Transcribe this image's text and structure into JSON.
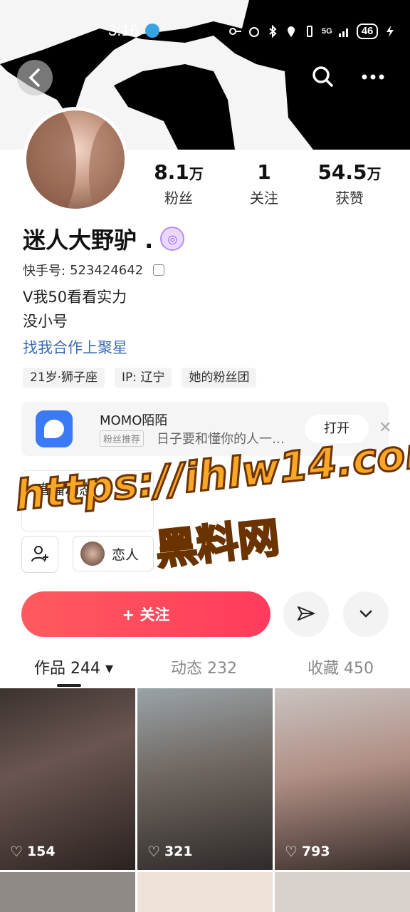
{
  "status_bar": {
    "time": "3:16",
    "network": "5G",
    "battery": "46"
  },
  "header": {
    "back_icon": "chevron-left-icon",
    "search_icon": "search-icon",
    "more_icon": "more-dots-icon"
  },
  "profile": {
    "name": "迷人大野驴 .",
    "kuaishou_id_label": "快手号:",
    "kuaishou_id": "523424642",
    "bio_line1": "V我50看看实力",
    "bio_line2": "没小号",
    "business_link": "找我合作上聚星",
    "tags": [
      "21岁·狮子座",
      "IP: 辽宁",
      "她的粉丝团"
    ]
  },
  "stats": [
    {
      "value": "8.1",
      "unit": "万",
      "label": "粉丝"
    },
    {
      "value": "1",
      "unit": "",
      "label": "关注"
    },
    {
      "value": "54.5",
      "unit": "万",
      "label": "获赞"
    }
  ],
  "ad": {
    "app_name": "MOMO陌陌",
    "tag": "粉丝推荐",
    "description": "日子要和懂你的人一…",
    "open_label": "打开",
    "close_label": "✕"
  },
  "live_card": {
    "title": "直播动态"
  },
  "relation": {
    "lover_label": "恋人"
  },
  "actions": {
    "follow_label": "+ 关注"
  },
  "tabs": [
    {
      "label": "作品 244 ▾"
    },
    {
      "label": "动态 232"
    },
    {
      "label": "收藏 450"
    }
  ],
  "posts": [
    {
      "likes": "154"
    },
    {
      "likes": "321"
    },
    {
      "likes": "793"
    }
  ],
  "watermark": {
    "line1": "https://ihlw14.com",
    "line2": "黑料网"
  },
  "colors": {
    "follow_gradient_start": "#ff5a5f",
    "follow_gradient_end": "#ff3b5c",
    "link_blue": "#3d6cb3",
    "watermark_orange": "#f9a826"
  }
}
